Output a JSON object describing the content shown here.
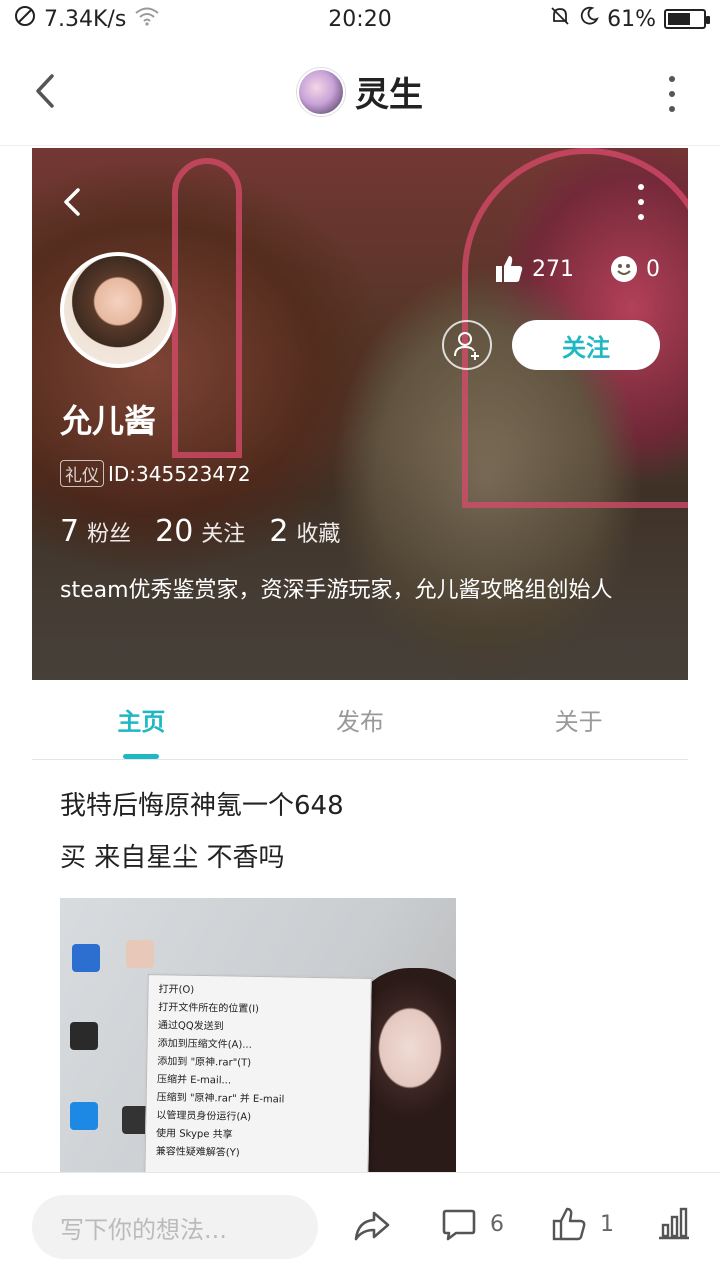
{
  "status_bar": {
    "network_speed": "7.34K/s",
    "time": "20:20",
    "battery_level": "61%"
  },
  "header": {
    "title": "灵生"
  },
  "profile": {
    "nickname": "允儿酱",
    "badge": "礼仪",
    "user_id": "ID:345523472",
    "likes": "271",
    "smiles": "0",
    "follow_label": "关注",
    "counts": [
      {
        "number": "7",
        "label": "粉丝"
      },
      {
        "number": "20",
        "label": "关注"
      },
      {
        "number": "2",
        "label": "收藏"
      }
    ],
    "bio": "steam优秀鉴赏家，资深手游玩家，允儿酱攻略组创始人"
  },
  "tabs": [
    {
      "label": "主页",
      "active": true
    },
    {
      "label": "发布",
      "active": false
    },
    {
      "label": "关于",
      "active": false
    }
  ],
  "post": {
    "line1": "我特后悔原神氪一个648",
    "line2": "买 来自星尘 不香吗",
    "context_menu": [
      "打开(O)",
      "打开文件所在的位置(I)",
      "通过QQ发送到",
      "添加到压缩文件(A)...",
      "添加到 \"原神.rar\"(T)",
      "压缩并 E-mail...",
      "压缩到 \"原神.rar\" 并 E-mail",
      "以管理员身份运行(A)",
      "使用 Skype 共享",
      "兼容性疑难解答(Y)"
    ]
  },
  "bottom_bar": {
    "input_placeholder": "写下你的想法...",
    "comments": "6",
    "likes": "1"
  },
  "colors": {
    "accent": "#1fb7c4"
  }
}
